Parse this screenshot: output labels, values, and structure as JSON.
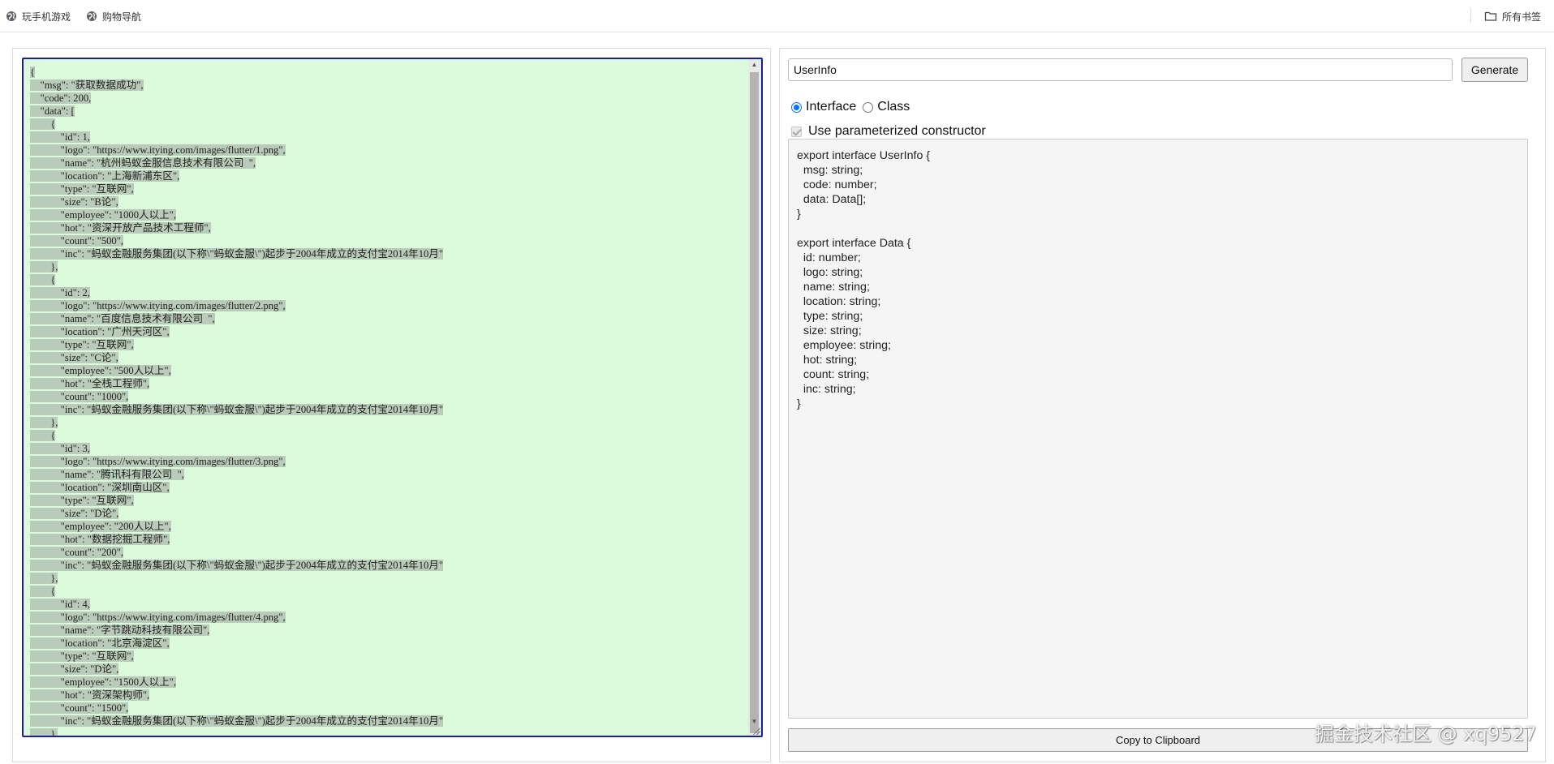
{
  "bookmarks": {
    "items": [
      {
        "label": "玩手机游戏",
        "icon": "globe-icon"
      },
      {
        "label": "购物导航",
        "icon": "globe-icon"
      }
    ],
    "all_bookmarks": {
      "label": "所有书签",
      "icon": "folder-icon"
    }
  },
  "json_input": {
    "lines": [
      "{",
      "    \"msg\": \"获取数据成功\",",
      "    \"code\": 200,",
      "    \"data\": [",
      "        {",
      "            \"id\": 1,",
      "            \"logo\": \"https://www.itying.com/images/flutter/1.png\",",
      "            \"name\": \"杭州蚂蚁金服信息技术有限公司  \",",
      "            \"location\": \"上海新浦东区\",",
      "            \"type\": \"互联网\",",
      "            \"size\": \"B论\",",
      "            \"employee\": \"1000人以上\",",
      "            \"hot\": \"资深开放产品技术工程师\",",
      "            \"count\": \"500\",",
      "            \"inc\": \"蚂蚁金融服务集团(以下称\\\"蚂蚁金服\\\")起步于2004年成立的支付宝2014年10月\"",
      "        },",
      "        {",
      "            \"id\": 2,",
      "            \"logo\": \"https://www.itying.com/images/flutter/2.png\",",
      "            \"name\": \"百度信息技术有限公司  \",",
      "            \"location\": \"广州天河区\",",
      "            \"type\": \"互联网\",",
      "            \"size\": \"C论\",",
      "            \"employee\": \"500人以上\",",
      "            \"hot\": \"全栈工程师\",",
      "            \"count\": \"1000\",",
      "            \"inc\": \"蚂蚁金融服务集团(以下称\\\"蚂蚁金服\\\")起步于2004年成立的支付宝2014年10月\"",
      "        },",
      "        {",
      "            \"id\": 3,",
      "            \"logo\": \"https://www.itying.com/images/flutter/3.png\",",
      "            \"name\": \"腾讯科有限公司  \",",
      "            \"location\": \"深圳南山区\",",
      "            \"type\": \"互联网\",",
      "            \"size\": \"D论\",",
      "            \"employee\": \"200人以上\",",
      "            \"hot\": \"数据挖掘工程师\",",
      "            \"count\": \"200\",",
      "            \"inc\": \"蚂蚁金融服务集团(以下称\\\"蚂蚁金服\\\")起步于2004年成立的支付宝2014年10月\"",
      "        },",
      "        {",
      "            \"id\": 4,",
      "            \"logo\": \"https://www.itying.com/images/flutter/4.png\",",
      "            \"name\": \"字节跳动科技有限公司\",",
      "            \"location\": \"北京海淀区\",",
      "            \"type\": \"互联网\",",
      "            \"size\": \"D论\",",
      "            \"employee\": \"1500人以上\",",
      "            \"hot\": \"资深架构师\",",
      "            \"count\": \"1500\",",
      "            \"inc\": \"蚂蚁金融服务集团(以下称\\\"蚂蚁金服\\\")起步于2004年成立的支付宝2014年10月\"",
      "        },"
    ]
  },
  "generator": {
    "class_name_value": "UserInfo",
    "generate_label": "Generate",
    "type_options": [
      {
        "label": "Interface",
        "selected": true
      },
      {
        "label": "Class",
        "selected": false
      }
    ],
    "constructor_label": "Use parameterized constructor",
    "constructor_checked": true,
    "output_lines": [
      "export interface UserInfo {",
      "  msg: string;",
      "  code: number;",
      "  data: Data[];",
      "}",
      "",
      "export interface Data {",
      "  id: number;",
      "  logo: string;",
      "  name: string;",
      "  location: string;",
      "  type: string;",
      "  size: string;",
      "  employee: string;",
      "  hot: string;",
      "  count: string;",
      "  inc: string;",
      "}"
    ],
    "copy_label": "Copy to Clipboard"
  },
  "watermark": "掘金技术社区 @ xq9527",
  "colors": {
    "json_bg": "#dcfbdc",
    "selection": "#b9cbb9",
    "focus_border": "#1a1f9c",
    "radio_accent": "#0075ff"
  }
}
